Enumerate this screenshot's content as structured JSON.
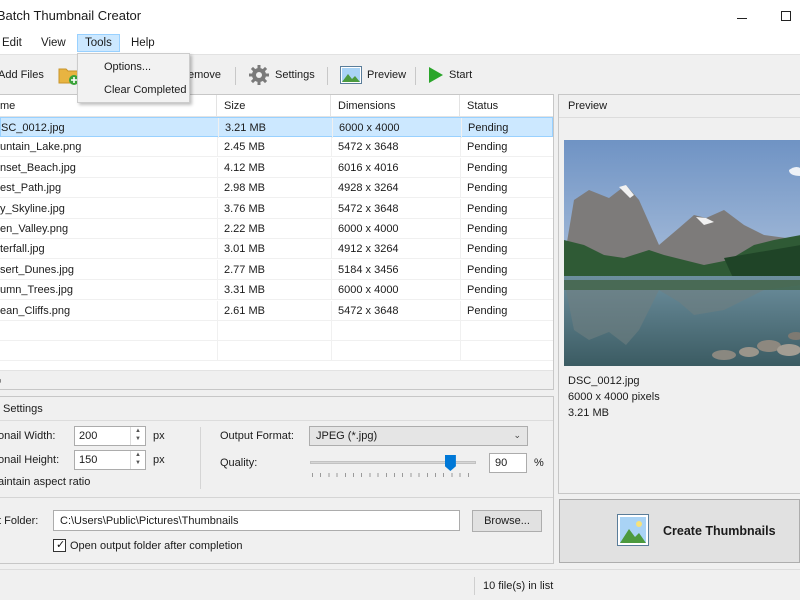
{
  "window": {
    "title": "e Batch Thumbnail Creator"
  },
  "menu": [
    {
      "label": "Edit"
    },
    {
      "label": "View"
    },
    {
      "label": "Tools"
    },
    {
      "label": "Help"
    }
  ],
  "tools_menu": {
    "items": [
      "Options...",
      "Clear Completed"
    ]
  },
  "toolbar": {
    "add_files": "Add Files",
    "remove": "emove",
    "settings": "Settings",
    "preview": "Preview",
    "start": "Start"
  },
  "file_list": {
    "columns": [
      "me",
      "Size",
      "Dimensions",
      "Status"
    ],
    "rows": [
      {
        "name": "SC_0012.jpg",
        "size": "3.21 MB",
        "dimensions": "6000 x 4000",
        "status": "Pending"
      },
      {
        "name": "untain_Lake.png",
        "size": "2.45 MB",
        "dimensions": "5472 x 3648",
        "status": "Pending"
      },
      {
        "name": "nset_Beach.jpg",
        "size": "4.12 MB",
        "dimensions": "6016 x 4016",
        "status": "Pending"
      },
      {
        "name": "est_Path.jpg",
        "size": "2.98 MB",
        "dimensions": "4928 x 3264",
        "status": "Pending"
      },
      {
        "name": "y_Skyline.jpg",
        "size": "3.76 MB",
        "dimensions": "5472 x 3648",
        "status": "Pending"
      },
      {
        "name": "en_Valley.png",
        "size": "2.22 MB",
        "dimensions": "6000 x 4000",
        "status": "Pending"
      },
      {
        "name": "terfall.jpg",
        "size": "3.01 MB",
        "dimensions": "4912 x 3264",
        "status": "Pending"
      },
      {
        "name": "sert_Dunes.jpg",
        "size": "2.77 MB",
        "dimensions": "5184 x 3456",
        "status": "Pending"
      },
      {
        "name": "umn_Trees.jpg",
        "size": "3.31 MB",
        "dimensions": "6000 x 4000",
        "status": "Pending"
      },
      {
        "name": "ean_Cliffs.png",
        "size": "2.61 MB",
        "dimensions": "5472 x 3648",
        "status": "Pending"
      }
    ]
  },
  "settings": {
    "header": "Settings",
    "width_label": "onail Width:",
    "width_value": "200",
    "width_unit": "px",
    "height_label": "onail Height:",
    "height_value": "150",
    "height_unit": "px",
    "aspect_label": "aintain aspect ratio",
    "format_label": "Output Format:",
    "format_value": "JPEG (*.jpg)",
    "quality_label": "Quality:",
    "quality_value": "90",
    "quality_unit": "%",
    "quality_level": 90,
    "folder_label": "t Folder:",
    "folder_value": "C:\\Users\\Public\\Pictures\\Thumbnails",
    "browse_label": "Browse...",
    "open_folder_label": "Open output folder after completion",
    "open_folder_checked": true
  },
  "preview": {
    "header": "Preview",
    "filename": "DSC_0012.jpg",
    "pixels": "6000 x 4000 pixels",
    "size": "3.21 MB"
  },
  "create_button": "Create Thumbnails",
  "status_bar": {
    "count_text": "10 file(s) in list"
  },
  "colors": {
    "accent": "#0078d7",
    "selection": "#cce8ff",
    "selection_border": "#99d1ff"
  }
}
